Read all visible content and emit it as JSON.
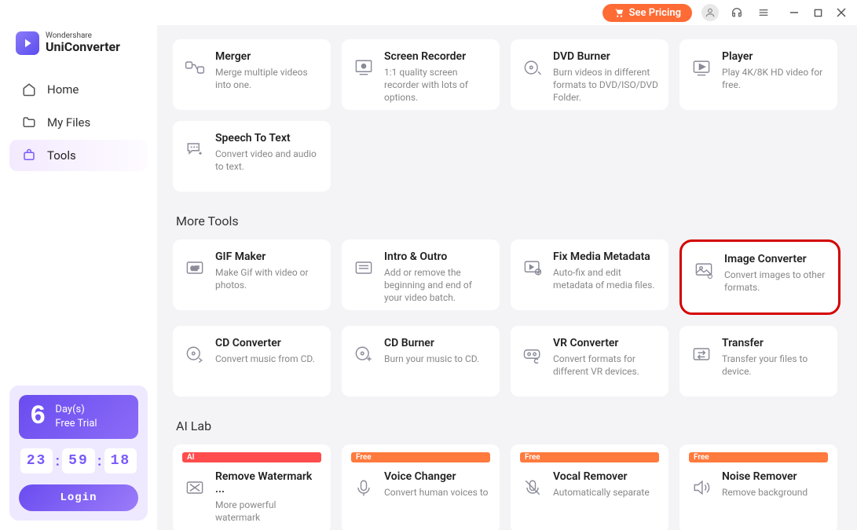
{
  "titlebar": {
    "pricing": "See Pricing"
  },
  "logo": {
    "top": "Wondershare",
    "bottom": "UniConverter"
  },
  "nav": {
    "home": "Home",
    "myfiles": "My Files",
    "tools": "Tools"
  },
  "trial": {
    "big_number": "6",
    "days_label": "Day(s)",
    "free_trial": "Free Trial",
    "hh": "23",
    "mm": "59",
    "ss": "18",
    "login": "Login"
  },
  "cards_top": [
    {
      "title": "Merger",
      "desc": "Merge multiple videos into one.",
      "icon": "merger-icon"
    },
    {
      "title": "Screen Recorder",
      "desc": "1:1 quality screen recorder with lots of options.",
      "icon": "screen-recorder-icon"
    },
    {
      "title": "DVD Burner",
      "desc": "Burn videos in different formats to DVD/ISO/DVD Folder.",
      "icon": "dvd-burner-icon"
    },
    {
      "title": "Player",
      "desc": "Play 4K/8K HD video for free.",
      "icon": "player-icon"
    },
    {
      "title": "Speech To Text",
      "desc": "Convert video and audio to text.",
      "icon": "speech-to-text-icon"
    }
  ],
  "section_more": "More Tools",
  "cards_more": [
    {
      "title": "GIF Maker",
      "desc": "Make Gif with video or photos.",
      "icon": "gif-maker-icon"
    },
    {
      "title": "Intro & Outro",
      "desc": "Add or remove the beginning and end of your video batch.",
      "icon": "intro-outro-icon"
    },
    {
      "title": "Fix Media Metadata",
      "desc": "Auto-fix and edit metadata of media files.",
      "icon": "metadata-icon"
    },
    {
      "title": "Image Converter",
      "desc": "Convert images to other formats.",
      "icon": "image-converter-icon",
      "highlighted": true
    },
    {
      "title": "CD Converter",
      "desc": "Convert music from CD.",
      "icon": "cd-converter-icon"
    },
    {
      "title": "CD Burner",
      "desc": "Burn your music to CD.",
      "icon": "cd-burner-icon"
    },
    {
      "title": "VR Converter",
      "desc": "Convert formats for different VR devices.",
      "icon": "vr-converter-icon"
    },
    {
      "title": "Transfer",
      "desc": "Transfer your files to device.",
      "icon": "transfer-icon"
    }
  ],
  "section_ai": "AI Lab",
  "cards_ai": [
    {
      "tag": "AI",
      "tag_class": "tag-ai",
      "title": "Remove Watermark ...",
      "desc": "More powerful watermark",
      "icon": "remove-watermark-icon"
    },
    {
      "tag": "Free",
      "tag_class": "tag-free",
      "title": "Voice Changer",
      "desc": "Convert human voices to",
      "icon": "voice-changer-icon"
    },
    {
      "tag": "Free",
      "tag_class": "tag-free",
      "title": "Vocal Remover",
      "desc": "Automatically separate",
      "icon": "vocal-remover-icon"
    },
    {
      "tag": "Free",
      "tag_class": "tag-free",
      "title": "Noise Remover",
      "desc": "Remove background",
      "icon": "noise-remover-icon"
    }
  ]
}
